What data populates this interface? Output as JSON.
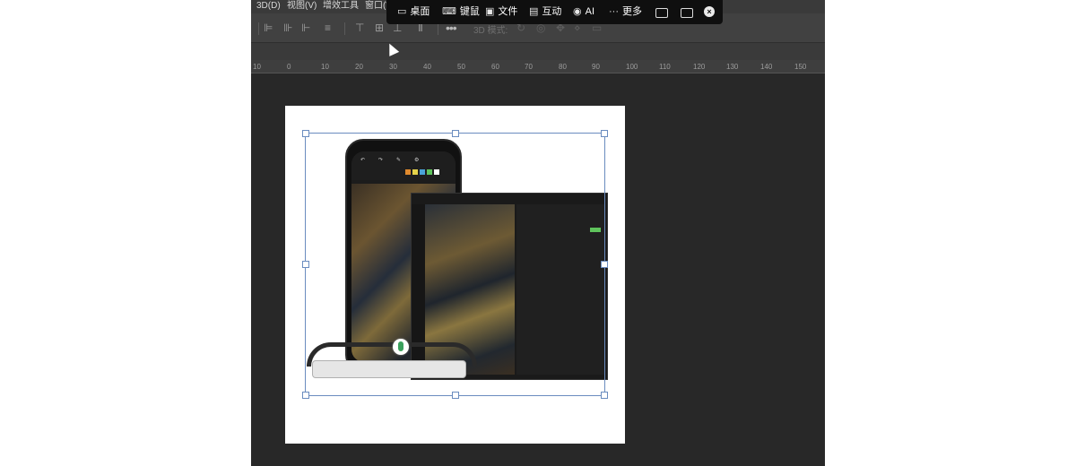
{
  "menubar": {
    "items": [
      "3D(D)",
      "视图(V)",
      "增效工具",
      "窗口(W"
    ]
  },
  "optionsbar": {
    "label_3d": "3D 模式:",
    "more": "•••"
  },
  "ruler": {
    "ticks": [
      "10",
      "0",
      "10",
      "20",
      "30",
      "40",
      "50",
      "60",
      "70",
      "80",
      "90",
      "100",
      "110",
      "120",
      "130",
      "140",
      "150"
    ]
  },
  "remote_toolbar": {
    "items": [
      {
        "label": "桌面",
        "icon": "monitor-icon"
      },
      {
        "label": "键鼠",
        "icon": "keyboard-icon"
      },
      {
        "label": "文件",
        "icon": "folder-icon"
      },
      {
        "label": "互动",
        "icon": "chat-icon"
      },
      {
        "label": "AI",
        "icon": "eye-icon"
      },
      {
        "label": "更多",
        "icon": "more-dots-icon"
      }
    ],
    "close_icon": "close-icon"
  },
  "canvas": {
    "image_description_icons": [
      "phone-mockup",
      "tablet-mockup",
      "smart-glasses"
    ]
  },
  "colors": {
    "app_bg": "#282828",
    "menubar": "#3a3a3a",
    "selection": "#6a8cbf",
    "remote_bar": "#0f0f0f",
    "accent_green": "#5fc35c"
  }
}
